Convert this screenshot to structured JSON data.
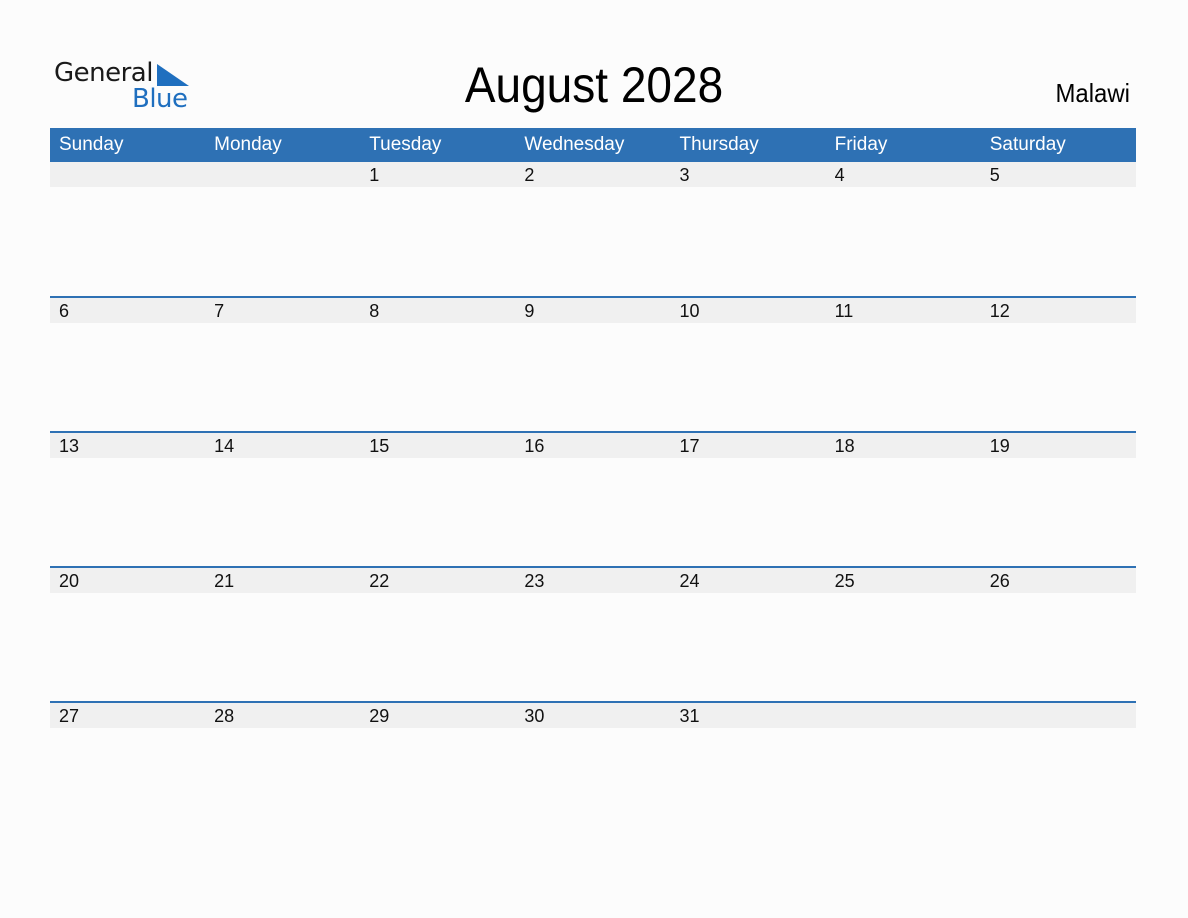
{
  "logo": {
    "line1": "General",
    "line2": "Blue"
  },
  "title": "August 2028",
  "country": "Malawi",
  "colors": {
    "accent": "#2e71b4",
    "strip": "#f0f0f0",
    "background": "#fcfcfc"
  },
  "weekdays": [
    "Sunday",
    "Monday",
    "Tuesday",
    "Wednesday",
    "Thursday",
    "Friday",
    "Saturday"
  ],
  "weeks": [
    [
      "",
      "",
      "1",
      "2",
      "3",
      "4",
      "5"
    ],
    [
      "6",
      "7",
      "8",
      "9",
      "10",
      "11",
      "12"
    ],
    [
      "13",
      "14",
      "15",
      "16",
      "17",
      "18",
      "19"
    ],
    [
      "20",
      "21",
      "22",
      "23",
      "24",
      "25",
      "26"
    ],
    [
      "27",
      "28",
      "29",
      "30",
      "31",
      "",
      ""
    ]
  ]
}
